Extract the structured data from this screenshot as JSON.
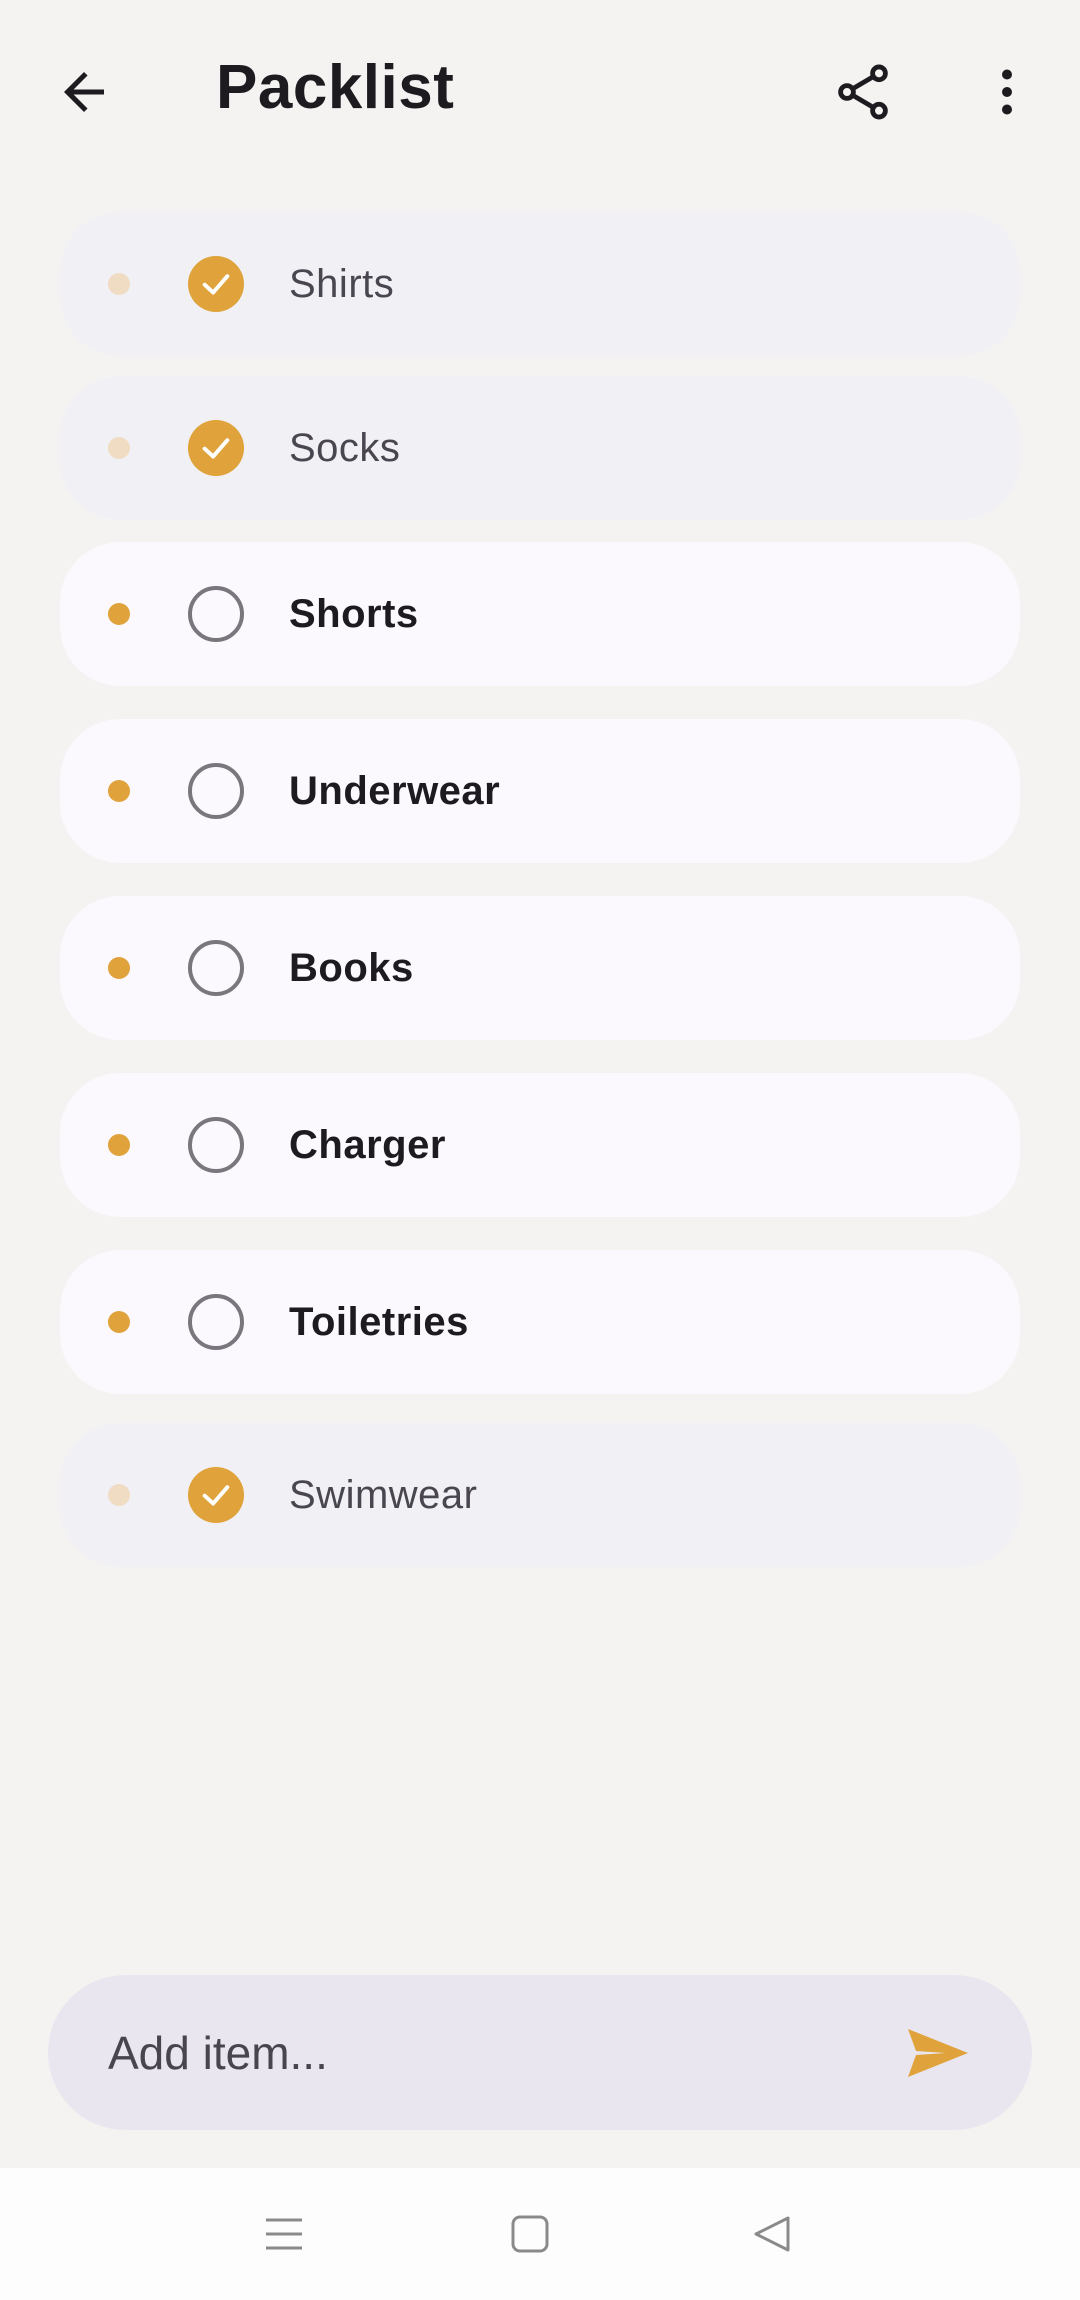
{
  "app_bar": {
    "title": "Packlist",
    "back_icon": "arrow-left-icon",
    "share_icon": "share-icon",
    "more_icon": "more-vertical-icon"
  },
  "items": [
    {
      "label": "Shirts",
      "checked": true
    },
    {
      "label": "Socks",
      "checked": true
    },
    {
      "label": "Shorts",
      "checked": false
    },
    {
      "label": "Underwear",
      "checked": false
    },
    {
      "label": "Books",
      "checked": false
    },
    {
      "label": "Charger",
      "checked": false
    },
    {
      "label": "Toiletries",
      "checked": false
    },
    {
      "label": "Swimwear",
      "checked": true
    }
  ],
  "add_item": {
    "placeholder": "Add item...",
    "value": "",
    "send_icon": "send-icon"
  },
  "system_nav": {
    "menu_icon": "recent-apps-icon",
    "home_icon": "home-icon",
    "back_icon": "back-triangle-icon"
  },
  "colors": {
    "accent": "#e0a23a",
    "background": "#f5f3f1",
    "item_todo_bg": "#fbf8fe",
    "item_done_bg": "#f1f0f5",
    "input_bg": "#e9e6ef"
  }
}
